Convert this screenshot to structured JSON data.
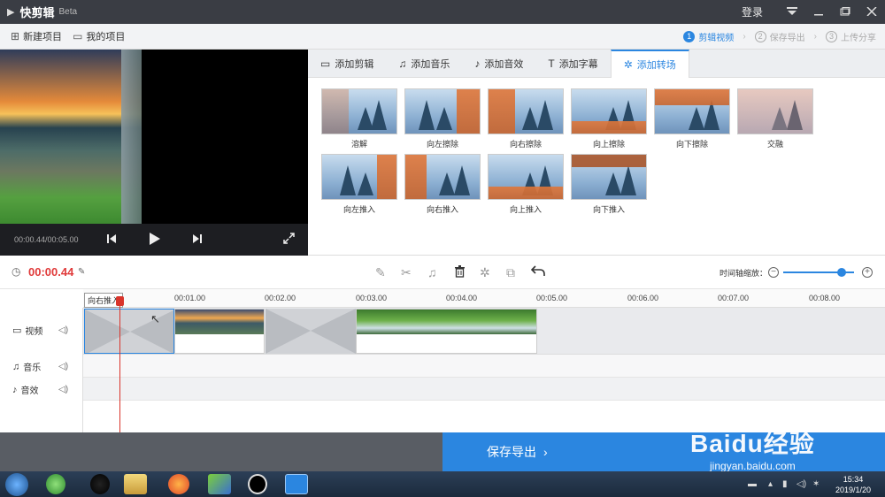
{
  "titlebar": {
    "app_name": "快剪辑",
    "beta": "Beta",
    "login": "登录",
    "icons": [
      "logo-icon",
      "menu-icon",
      "minimize-icon",
      "maximize-icon",
      "close-icon"
    ]
  },
  "menubar": {
    "new_project": "新建项目",
    "my_projects": "我的项目",
    "steps": [
      {
        "num": "1",
        "label": "剪辑视频",
        "active": true
      },
      {
        "num": "2",
        "label": "保存导出",
        "active": false
      },
      {
        "num": "3",
        "label": "上传分享",
        "active": false
      }
    ]
  },
  "preview": {
    "time": "00:00.44/00:05.00"
  },
  "tabs": [
    {
      "label": "添加剪辑",
      "icon": "film-icon",
      "active": false
    },
    {
      "label": "添加音乐",
      "icon": "music-icon",
      "active": false
    },
    {
      "label": "添加音效",
      "icon": "sound-effect-icon",
      "active": false
    },
    {
      "label": "添加字幕",
      "icon": "text-icon",
      "active": false
    },
    {
      "label": "添加转场",
      "icon": "transition-icon",
      "active": true
    }
  ],
  "transitions": [
    {
      "label": "溶解"
    },
    {
      "label": "向左擦除"
    },
    {
      "label": "向右擦除"
    },
    {
      "label": "向上擦除"
    },
    {
      "label": "向下擦除"
    },
    {
      "label": "交融"
    },
    {
      "label": "向左推入"
    },
    {
      "label": "向右推入"
    },
    {
      "label": "向上推入"
    },
    {
      "label": "向下推入"
    }
  ],
  "toolbar": {
    "current_time": "00:00.44",
    "zoom_label": "时间轴缩放：",
    "zoom_level": 0.83
  },
  "ruler": {
    "ticks": [
      "00:01.00",
      "00:02.00",
      "00:03.00",
      "00:04.00",
      "00:05.00",
      "00:06.00",
      "00:07.00",
      "00:08.00"
    ]
  },
  "tracks": {
    "video": "视频",
    "music": "音乐",
    "sfx": "音效"
  },
  "clip_tag": "向右推入",
  "footer": {
    "export": "保存导出"
  },
  "taskbar": {
    "time": "15:34",
    "date": "2019/1/20"
  },
  "watermark": {
    "brand": "Baidu经验",
    "url": "jingyan.baidu.com"
  },
  "colors": {
    "accent": "#2b86e0",
    "time_red": "#e03a3a",
    "titlebar": "#3a3d44"
  }
}
